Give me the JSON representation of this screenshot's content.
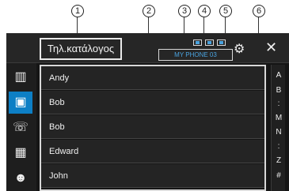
{
  "callouts": [
    "1",
    "2",
    "3",
    "4",
    "5",
    "6"
  ],
  "header": {
    "title": "Τηλ.κατάλογος",
    "device_name": "MY PHONE 03"
  },
  "sidebar": {
    "items": [
      {
        "icon": "phonebook-book-icon"
      },
      {
        "icon": "contacts-icon"
      },
      {
        "icon": "call-history-icon"
      },
      {
        "icon": "keypad-icon"
      },
      {
        "icon": "voice-recognition-icon"
      }
    ]
  },
  "contacts": [
    "Andy",
    "Bob",
    "Bob",
    "Edward",
    "John"
  ],
  "alphabet": [
    "A",
    "B",
    ":",
    "M",
    "N",
    ":",
    "Z",
    "#"
  ],
  "colors": {
    "accent": "#0d7fc5",
    "device_text": "#4aa3df",
    "background": "#151515"
  }
}
